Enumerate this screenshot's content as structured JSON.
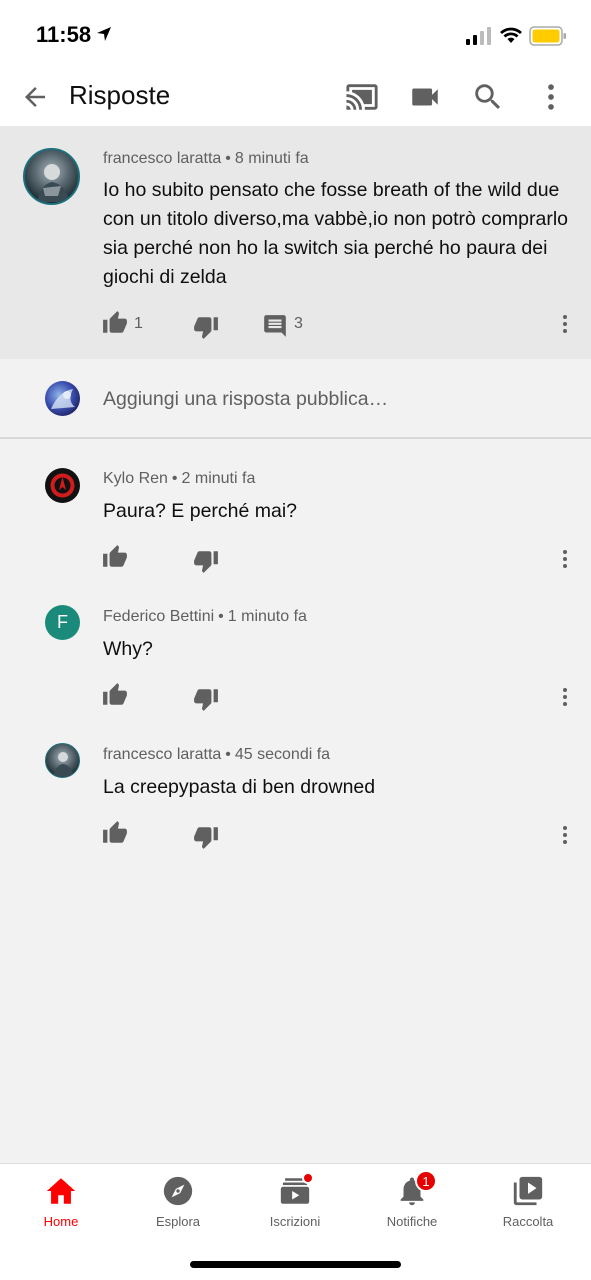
{
  "status_bar": {
    "time": "11:58"
  },
  "app_bar": {
    "title": "Risposte"
  },
  "parent_comment": {
    "author": "francesco laratta",
    "separator": "•",
    "time": "8 minuti fa",
    "text": "Io ho subito pensato che fosse breath of the wild due con un titolo diverso,ma vabbè,io non potrò comprarlo sia perché non ho la switch sia perché ho paura dei giochi di zelda",
    "likes": "1",
    "replies": "3"
  },
  "reply_input": {
    "placeholder": "Aggiungi una risposta pubblica…"
  },
  "replies": [
    {
      "author": "Kylo Ren",
      "separator": "•",
      "time": "2 minuti fa",
      "text": "Paura? E perché mai?"
    },
    {
      "author": "Federico Bettini",
      "separator": "•",
      "time": "1 minuto fa",
      "text": "Why?",
      "avatar_letter": "F"
    },
    {
      "author": "francesco laratta",
      "separator": "•",
      "time": "45 secondi fa",
      "text": "La creepypasta di ben drowned"
    }
  ],
  "bottom_nav": {
    "items": [
      {
        "label": "Home",
        "icon": "home-icon",
        "active": true
      },
      {
        "label": "Esplora",
        "icon": "compass-icon"
      },
      {
        "label": "Iscrizioni",
        "icon": "subscriptions-icon"
      },
      {
        "label": "Notifiche",
        "icon": "bell-icon",
        "badge": "1"
      },
      {
        "label": "Raccolta",
        "icon": "library-icon"
      }
    ]
  },
  "colors": {
    "accent": "#ff0000",
    "parent_bg": "#e8e8e8",
    "page_bg": "#f2f2f2",
    "meta_text": "#606060"
  }
}
